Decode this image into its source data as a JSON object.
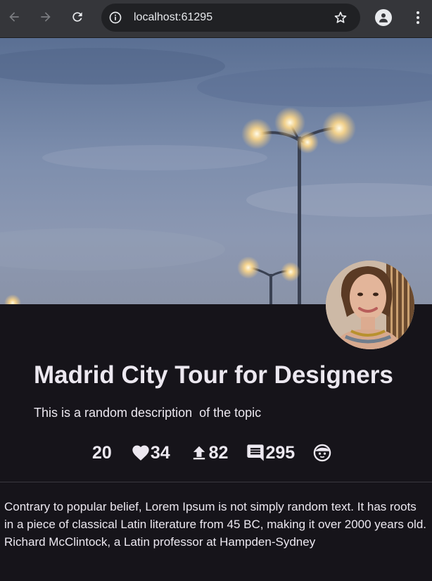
{
  "browser": {
    "url": "localhost:61295",
    "icons": [
      "back-arrow-icon",
      "forward-arrow-icon",
      "reload-icon",
      "site-info-icon",
      "bookmark-star-icon",
      "profile-icon",
      "more-vert-icon"
    ]
  },
  "topic": {
    "title": "Madrid City Tour for Designers",
    "description": "This is a random description  of the topic",
    "stats": {
      "count": "20",
      "likes": "34",
      "shares": "82",
      "comments": "295"
    },
    "body": "Contrary to popular belief, Lorem Ipsum is not simply random text. It has roots in a piece of classical Latin literature from 45 BC, making it over 2000 years old. Richard McClintock, a Latin professor at Hampden-Sydney"
  },
  "colors": {
    "background": "#16141a",
    "text": "#ece8f0",
    "chrome": "#35363a"
  }
}
